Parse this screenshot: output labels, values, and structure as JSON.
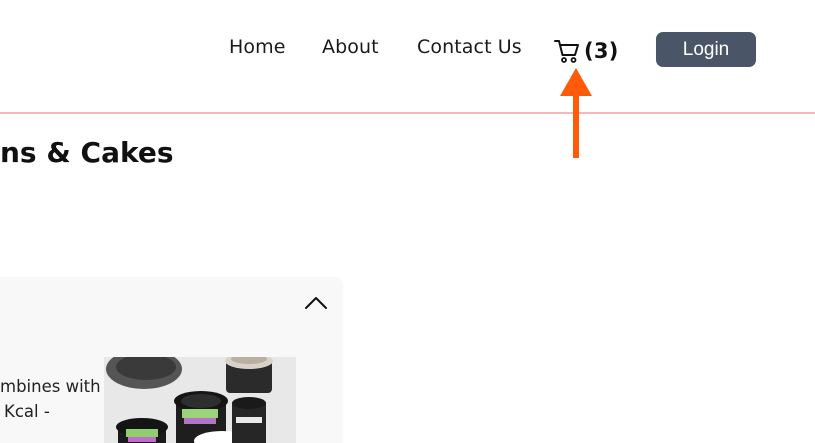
{
  "nav": {
    "home": "Home",
    "about": "About",
    "contact": "Contact Us"
  },
  "cart": {
    "count_label": "(3)",
    "icon": "cart-icon"
  },
  "login": {
    "label": "Login"
  },
  "section": {
    "heading": "ns & Cakes"
  },
  "card": {
    "description_lines": [
      "mbines with",
      "Kcal -"
    ],
    "toggle_icon": "chevron-up-icon"
  },
  "colors": {
    "login_bg": "#4a5668",
    "header_border": "#f4b9b9",
    "annotation_arrow": "#ff5a0a",
    "card_bg": "#f8f8f9"
  }
}
